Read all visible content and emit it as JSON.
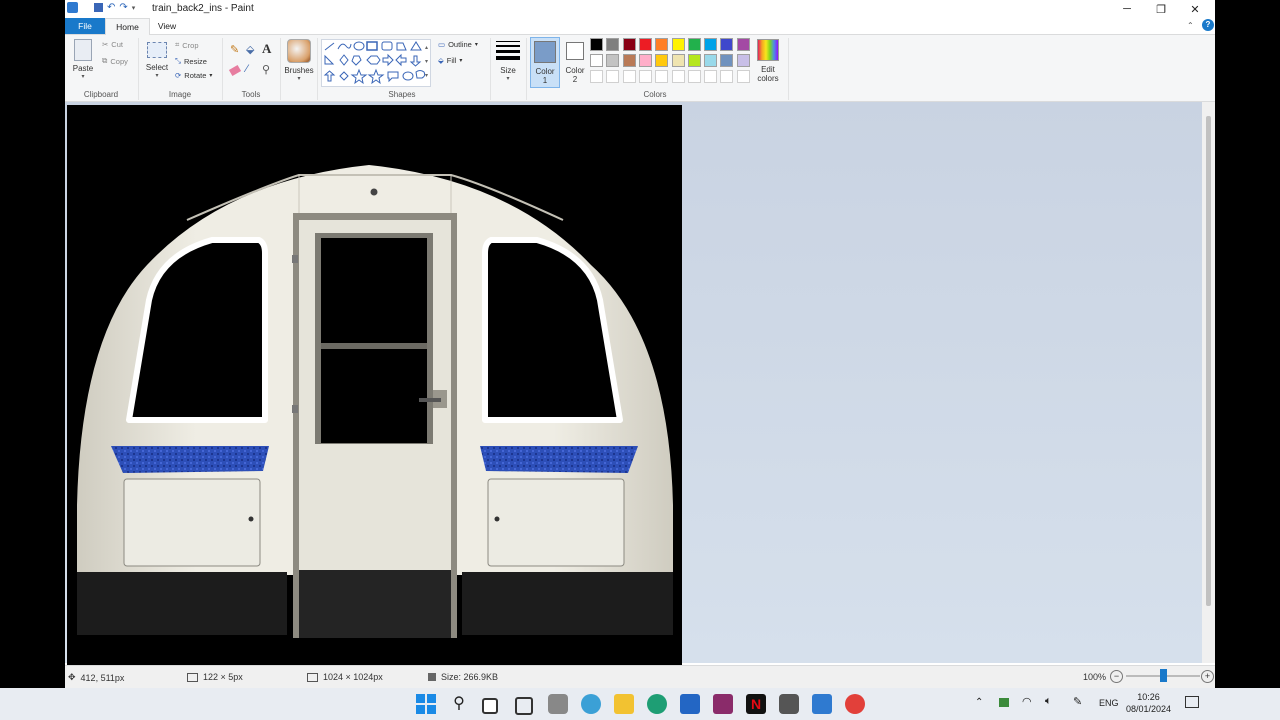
{
  "window": {
    "title": "train_back2_ins - Paint",
    "controls": [
      "minimize",
      "restore",
      "close"
    ]
  },
  "tabs": [
    {
      "label": "File"
    },
    {
      "label": "Home"
    },
    {
      "label": "View"
    }
  ],
  "ribbon": {
    "clipboard": {
      "label": "Clipboard",
      "paste": "Paste",
      "cut": "Cut",
      "copy": "Copy"
    },
    "image": {
      "label": "Image",
      "select": "Select",
      "crop": "Crop",
      "resize": "Resize",
      "rotate": "Rotate"
    },
    "tools": {
      "label": "Tools"
    },
    "brushes": {
      "label": "Brushes"
    },
    "shapes": {
      "label": "Shapes",
      "outline": "Outline",
      "fill": "Fill"
    },
    "size": {
      "label": "Size"
    },
    "color1": {
      "label": "Color",
      "sub": "1",
      "color": "#7a9cc8"
    },
    "color2": {
      "label": "Color",
      "sub": "2",
      "color": "#ffffff"
    },
    "colors": {
      "label": "Colors"
    },
    "edit_colors": {
      "label": "Edit",
      "sub": "colors"
    },
    "palette": [
      "#000000",
      "#7f7f7f",
      "#880015",
      "#ed1c24",
      "#ff7f27",
      "#fff200",
      "#22b14c",
      "#00a2e8",
      "#3f48cc",
      "#a349a4",
      "#ffffff",
      "#c3c3c3",
      "#b97a57",
      "#ffaec9",
      "#ffc90e",
      "#efe4b0",
      "#b5e61d",
      "#99d9ea",
      "#7092be",
      "#c8bfe7"
    ]
  },
  "status": {
    "cursor_pos": "412, 511px",
    "selection_size": "122 × 5px",
    "image_size": "1024 × 1024px",
    "file_size": "Size: 266.9KB",
    "zoom": "100%",
    "zoom_level": 0.5
  },
  "taskbar": {
    "icons": [
      "windows-start-icon",
      "search-icon",
      "task-view-icon",
      "widgets-icon",
      "app-icon",
      "edge-icon",
      "explorer-icon",
      "edge-browser-icon",
      "store-icon",
      "winrar-icon",
      "netflix-icon",
      "camera-icon",
      "paint-icon",
      "chrome-icon"
    ],
    "language": "ENG",
    "time": "10:26",
    "date": "08/01/2024"
  }
}
